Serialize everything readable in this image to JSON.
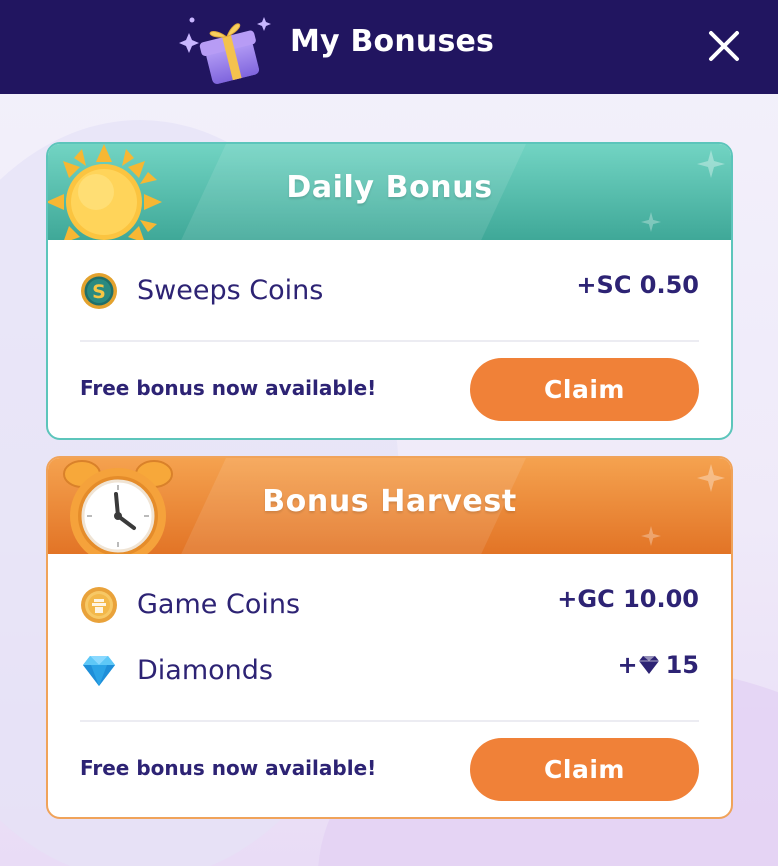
{
  "header": {
    "title": "My Bonuses",
    "gift_icon": "gift-box-icon",
    "close_icon": "close-icon",
    "background_color": "#211560"
  },
  "daily_bonus": {
    "title": "Daily Bonus",
    "art_icon": "sun-icon",
    "accent_color": "#5cc5bb",
    "rewards": [
      {
        "icon": "sweeps-coin-icon",
        "label": "Sweeps Coins",
        "amount": "+SC 0.50"
      }
    ],
    "status_text": "Free bonus now available!",
    "claim_label": "Claim"
  },
  "bonus_harvest": {
    "title": "Bonus Harvest",
    "art_icon": "alarm-clock-icon",
    "accent_color": "#f0a35a",
    "rewards": [
      {
        "icon": "game-coin-icon",
        "label": "Game Coins",
        "amount": "+GC 10.00"
      },
      {
        "icon": "diamond-icon",
        "label": "Diamonds",
        "amount_prefix": "+",
        "amount_icon": "diamond-icon",
        "amount_value": "15"
      }
    ],
    "status_text": "Free bonus now available!",
    "claim_label": "Claim"
  },
  "button_color": "#f08138",
  "text_color": "#2d2374"
}
